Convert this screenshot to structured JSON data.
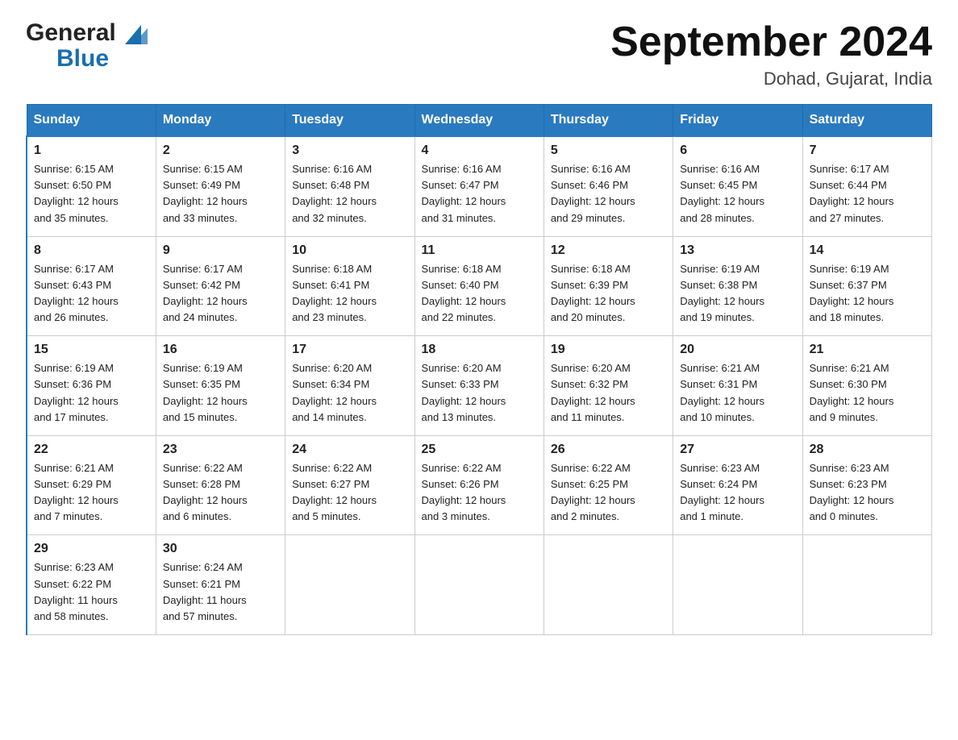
{
  "header": {
    "logo_general": "General",
    "logo_blue": "Blue",
    "title": "September 2024",
    "subtitle": "Dohad, Gujarat, India"
  },
  "days_of_week": [
    "Sunday",
    "Monday",
    "Tuesday",
    "Wednesday",
    "Thursday",
    "Friday",
    "Saturday"
  ],
  "weeks": [
    [
      {
        "day": "1",
        "sunrise": "6:15 AM",
        "sunset": "6:50 PM",
        "daylight": "12 hours and 35 minutes."
      },
      {
        "day": "2",
        "sunrise": "6:15 AM",
        "sunset": "6:49 PM",
        "daylight": "12 hours and 33 minutes."
      },
      {
        "day": "3",
        "sunrise": "6:16 AM",
        "sunset": "6:48 PM",
        "daylight": "12 hours and 32 minutes."
      },
      {
        "day": "4",
        "sunrise": "6:16 AM",
        "sunset": "6:47 PM",
        "daylight": "12 hours and 31 minutes."
      },
      {
        "day": "5",
        "sunrise": "6:16 AM",
        "sunset": "6:46 PM",
        "daylight": "12 hours and 29 minutes."
      },
      {
        "day": "6",
        "sunrise": "6:16 AM",
        "sunset": "6:45 PM",
        "daylight": "12 hours and 28 minutes."
      },
      {
        "day": "7",
        "sunrise": "6:17 AM",
        "sunset": "6:44 PM",
        "daylight": "12 hours and 27 minutes."
      }
    ],
    [
      {
        "day": "8",
        "sunrise": "6:17 AM",
        "sunset": "6:43 PM",
        "daylight": "12 hours and 26 minutes."
      },
      {
        "day": "9",
        "sunrise": "6:17 AM",
        "sunset": "6:42 PM",
        "daylight": "12 hours and 24 minutes."
      },
      {
        "day": "10",
        "sunrise": "6:18 AM",
        "sunset": "6:41 PM",
        "daylight": "12 hours and 23 minutes."
      },
      {
        "day": "11",
        "sunrise": "6:18 AM",
        "sunset": "6:40 PM",
        "daylight": "12 hours and 22 minutes."
      },
      {
        "day": "12",
        "sunrise": "6:18 AM",
        "sunset": "6:39 PM",
        "daylight": "12 hours and 20 minutes."
      },
      {
        "day": "13",
        "sunrise": "6:19 AM",
        "sunset": "6:38 PM",
        "daylight": "12 hours and 19 minutes."
      },
      {
        "day": "14",
        "sunrise": "6:19 AM",
        "sunset": "6:37 PM",
        "daylight": "12 hours and 18 minutes."
      }
    ],
    [
      {
        "day": "15",
        "sunrise": "6:19 AM",
        "sunset": "6:36 PM",
        "daylight": "12 hours and 17 minutes."
      },
      {
        "day": "16",
        "sunrise": "6:19 AM",
        "sunset": "6:35 PM",
        "daylight": "12 hours and 15 minutes."
      },
      {
        "day": "17",
        "sunrise": "6:20 AM",
        "sunset": "6:34 PM",
        "daylight": "12 hours and 14 minutes."
      },
      {
        "day": "18",
        "sunrise": "6:20 AM",
        "sunset": "6:33 PM",
        "daylight": "12 hours and 13 minutes."
      },
      {
        "day": "19",
        "sunrise": "6:20 AM",
        "sunset": "6:32 PM",
        "daylight": "12 hours and 11 minutes."
      },
      {
        "day": "20",
        "sunrise": "6:21 AM",
        "sunset": "6:31 PM",
        "daylight": "12 hours and 10 minutes."
      },
      {
        "day": "21",
        "sunrise": "6:21 AM",
        "sunset": "6:30 PM",
        "daylight": "12 hours and 9 minutes."
      }
    ],
    [
      {
        "day": "22",
        "sunrise": "6:21 AM",
        "sunset": "6:29 PM",
        "daylight": "12 hours and 7 minutes."
      },
      {
        "day": "23",
        "sunrise": "6:22 AM",
        "sunset": "6:28 PM",
        "daylight": "12 hours and 6 minutes."
      },
      {
        "day": "24",
        "sunrise": "6:22 AM",
        "sunset": "6:27 PM",
        "daylight": "12 hours and 5 minutes."
      },
      {
        "day": "25",
        "sunrise": "6:22 AM",
        "sunset": "6:26 PM",
        "daylight": "12 hours and 3 minutes."
      },
      {
        "day": "26",
        "sunrise": "6:22 AM",
        "sunset": "6:25 PM",
        "daylight": "12 hours and 2 minutes."
      },
      {
        "day": "27",
        "sunrise": "6:23 AM",
        "sunset": "6:24 PM",
        "daylight": "12 hours and 1 minute."
      },
      {
        "day": "28",
        "sunrise": "6:23 AM",
        "sunset": "6:23 PM",
        "daylight": "12 hours and 0 minutes."
      }
    ],
    [
      {
        "day": "29",
        "sunrise": "6:23 AM",
        "sunset": "6:22 PM",
        "daylight": "11 hours and 58 minutes."
      },
      {
        "day": "30",
        "sunrise": "6:24 AM",
        "sunset": "6:21 PM",
        "daylight": "11 hours and 57 minutes."
      },
      null,
      null,
      null,
      null,
      null
    ]
  ],
  "labels": {
    "sunrise": "Sunrise:",
    "sunset": "Sunset:",
    "daylight": "Daylight:"
  }
}
